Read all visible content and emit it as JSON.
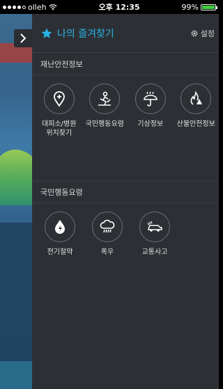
{
  "status_bar": {
    "carrier": "olleh",
    "time": "오후 12:35",
    "battery": "99%"
  },
  "drawer": {
    "title": "나의 즐겨찾기",
    "settings_label": "설정",
    "sections": [
      {
        "title": "재난안전정보",
        "items": [
          {
            "label": "대피소/병원\n위치찾기",
            "icon": "location-plus-icon"
          },
          {
            "label": "국민행동요령",
            "icon": "person-emergency-icon"
          },
          {
            "label": "기상정보",
            "icon": "weather-umbrella-icon"
          },
          {
            "label": "산불안전정보",
            "icon": "forest-fire-icon"
          }
        ]
      },
      {
        "title": "국민행동요령",
        "items": [
          {
            "label": "전기절약",
            "icon": "electricity-drop-icon"
          },
          {
            "label": "폭우",
            "icon": "heavy-rain-icon"
          },
          {
            "label": "교통사고",
            "icon": "car-accident-icon"
          }
        ]
      }
    ]
  },
  "colors": {
    "accent": "#27b4e6",
    "drawer_bg": "#2c3035",
    "battery": "#3ccf3c"
  }
}
